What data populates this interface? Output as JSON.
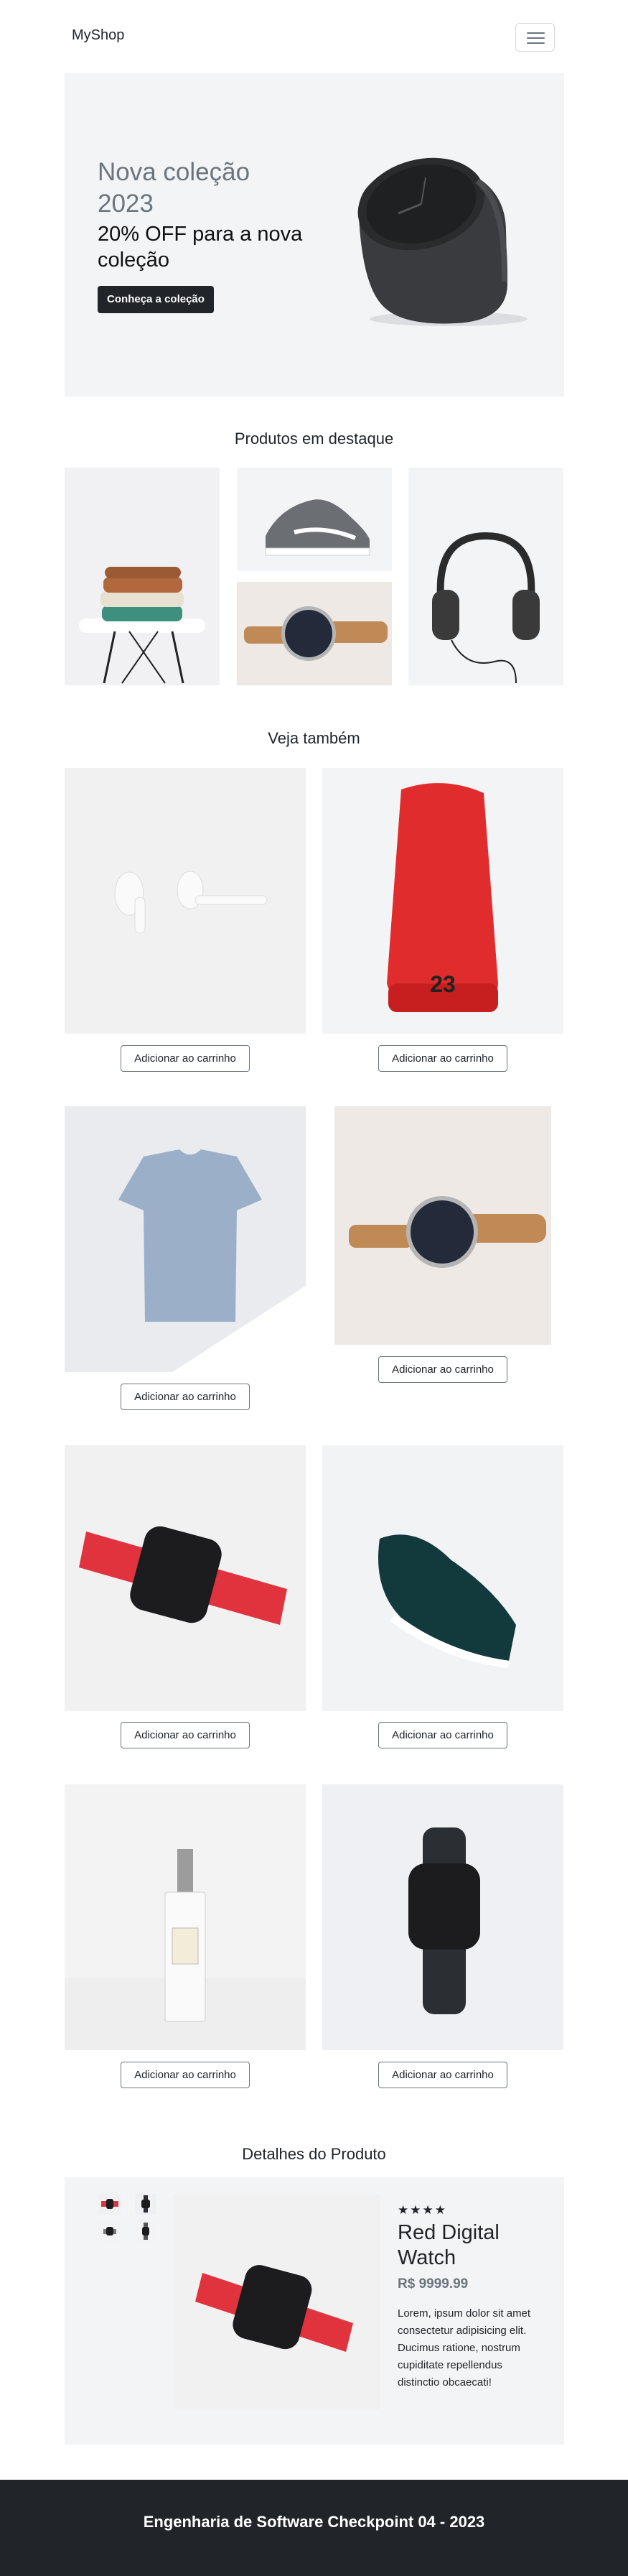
{
  "navbar": {
    "brand": "MyShop",
    "menu_icon": "hamburger-icon"
  },
  "hero": {
    "title": "Nova coleção 2023",
    "subtitle": "20% OFF para a nova coleção",
    "button": "Conheça a coleção"
  },
  "featured": {
    "title": "Produtos em destaque",
    "items": [
      "sweaters-on-chair",
      "sneaker",
      "wristwatch",
      "headphones"
    ]
  },
  "see_also": {
    "title": "Veja também",
    "button_label": "Adicionar ao carrinho",
    "items": [
      "airpods",
      "red-sneaker",
      "tshirt",
      "wristwatch",
      "red-smartwatch",
      "green-sneaker",
      "perfume",
      "black-smartwatch"
    ]
  },
  "details": {
    "title": "Detalhes do Produto",
    "stars": "★★★★",
    "rating": 4,
    "name": "Red Digital Watch",
    "price": "R$ 9999.99",
    "description": "Lorem, ipsum dolor sit amet consectetur adipisicing elit. Ducimus ratione, nostrum cupiditate repellendus distinctio obcaecati!"
  },
  "footer": {
    "text": "Engenharia de Software Checkpoint 04 - 2023"
  },
  "colors": {
    "dark": "#212529",
    "muted": "#6c757d",
    "light_bg": "#f3f4f6",
    "red": "#e0333e"
  }
}
